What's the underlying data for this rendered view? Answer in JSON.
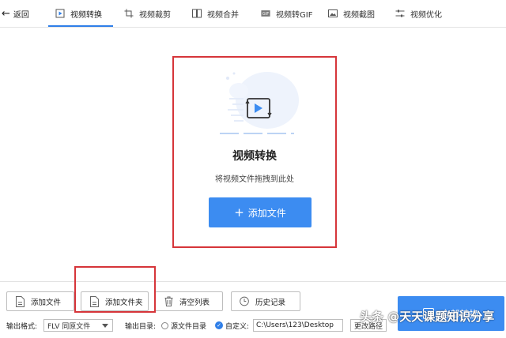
{
  "toolbar": {
    "back_label": "返回",
    "tabs": [
      {
        "label": "视频转换",
        "icon": "play-frame-icon",
        "active": true
      },
      {
        "label": "视频裁剪",
        "icon": "crop-icon",
        "active": false
      },
      {
        "label": "视频合并",
        "icon": "merge-icon",
        "active": false
      },
      {
        "label": "视频转GIF",
        "icon": "gif-icon",
        "active": false
      },
      {
        "label": "视频截图",
        "icon": "screenshot-icon",
        "active": false
      },
      {
        "label": "视频优化",
        "icon": "sliders-icon",
        "active": false
      }
    ]
  },
  "drop_area": {
    "title": "视频转换",
    "subtitle": "将视频文件拖拽到此处",
    "add_button_label": "添加文件",
    "icon": "convert-play-icon"
  },
  "bottom": {
    "add_file_label": "添加文件",
    "add_folder_label": "添加文件夹",
    "clear_list_label": "清空列表",
    "history_label": "历史记录",
    "convert_all_label": "全部转换",
    "output_format_label": "输出格式:",
    "output_format_value": "FLV 同原文件",
    "output_dir_label": "输出目录:",
    "source_dir_label": "源文件目录",
    "custom_label": "自定义:",
    "path_value": "C:\\Users\\123\\Desktop",
    "change_path_label": "更改路径"
  },
  "watermark": "头条 @天天课题知识分享",
  "colors": {
    "accent": "#3c8cf1",
    "highlight_border": "#d6353a"
  }
}
